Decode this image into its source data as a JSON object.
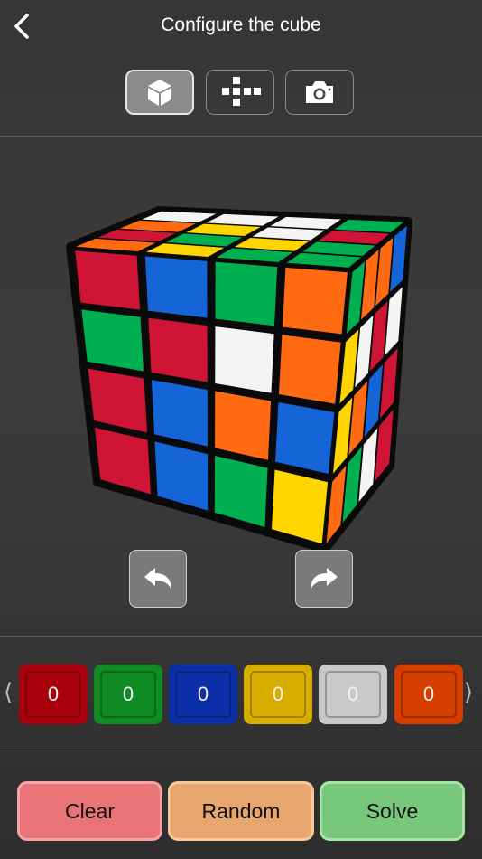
{
  "header": {
    "title": "Configure the cube"
  },
  "mode_tabs": [
    {
      "icon": "cube-icon",
      "active": true
    },
    {
      "icon": "cube-net-icon",
      "active": false
    },
    {
      "icon": "camera-icon",
      "active": false
    }
  ],
  "palette": {
    "left_arrow": "⟨",
    "right_arrow": "⟩",
    "colors": [
      {
        "name": "red",
        "count": "0",
        "color": "#a8000c"
      },
      {
        "name": "green",
        "count": "0",
        "color": "#108a22"
      },
      {
        "name": "blue",
        "count": "0",
        "color": "#0a2fa6"
      },
      {
        "name": "yellow",
        "count": "0",
        "color": "#d7ad00"
      },
      {
        "name": "white",
        "count": "0",
        "color": "#c9c9c9"
      },
      {
        "name": "orange",
        "count": "0",
        "color": "#d63e00"
      }
    ]
  },
  "actions": {
    "clear": "Clear",
    "random": "Random",
    "solve": "Solve"
  },
  "cube": {
    "colors": {
      "R": "#d01436",
      "G": "#00b050",
      "B": "#1565d8",
      "Y": "#ffd500",
      "W": "#f4f4f4",
      "O": "#ff6a13"
    },
    "front": [
      [
        "R",
        "B",
        "G",
        "O"
      ],
      [
        "G",
        "R",
        "W",
        "O"
      ],
      [
        "R",
        "B",
        "O",
        "B"
      ],
      [
        "R",
        "B",
        "G",
        "Y"
      ]
    ],
    "top": [
      [
        "W",
        "W",
        "W",
        "G"
      ],
      [
        "O",
        "Y",
        "W",
        "R"
      ],
      [
        "R",
        "G",
        "Y",
        "G"
      ],
      [
        "O",
        "Y",
        "G",
        "G"
      ]
    ],
    "right": [
      [
        "G",
        "O",
        "O",
        "B"
      ],
      [
        "Y",
        "W",
        "R",
        "W"
      ],
      [
        "Y",
        "O",
        "B",
        "R"
      ],
      [
        "O",
        "G",
        "W",
        "R"
      ]
    ]
  }
}
